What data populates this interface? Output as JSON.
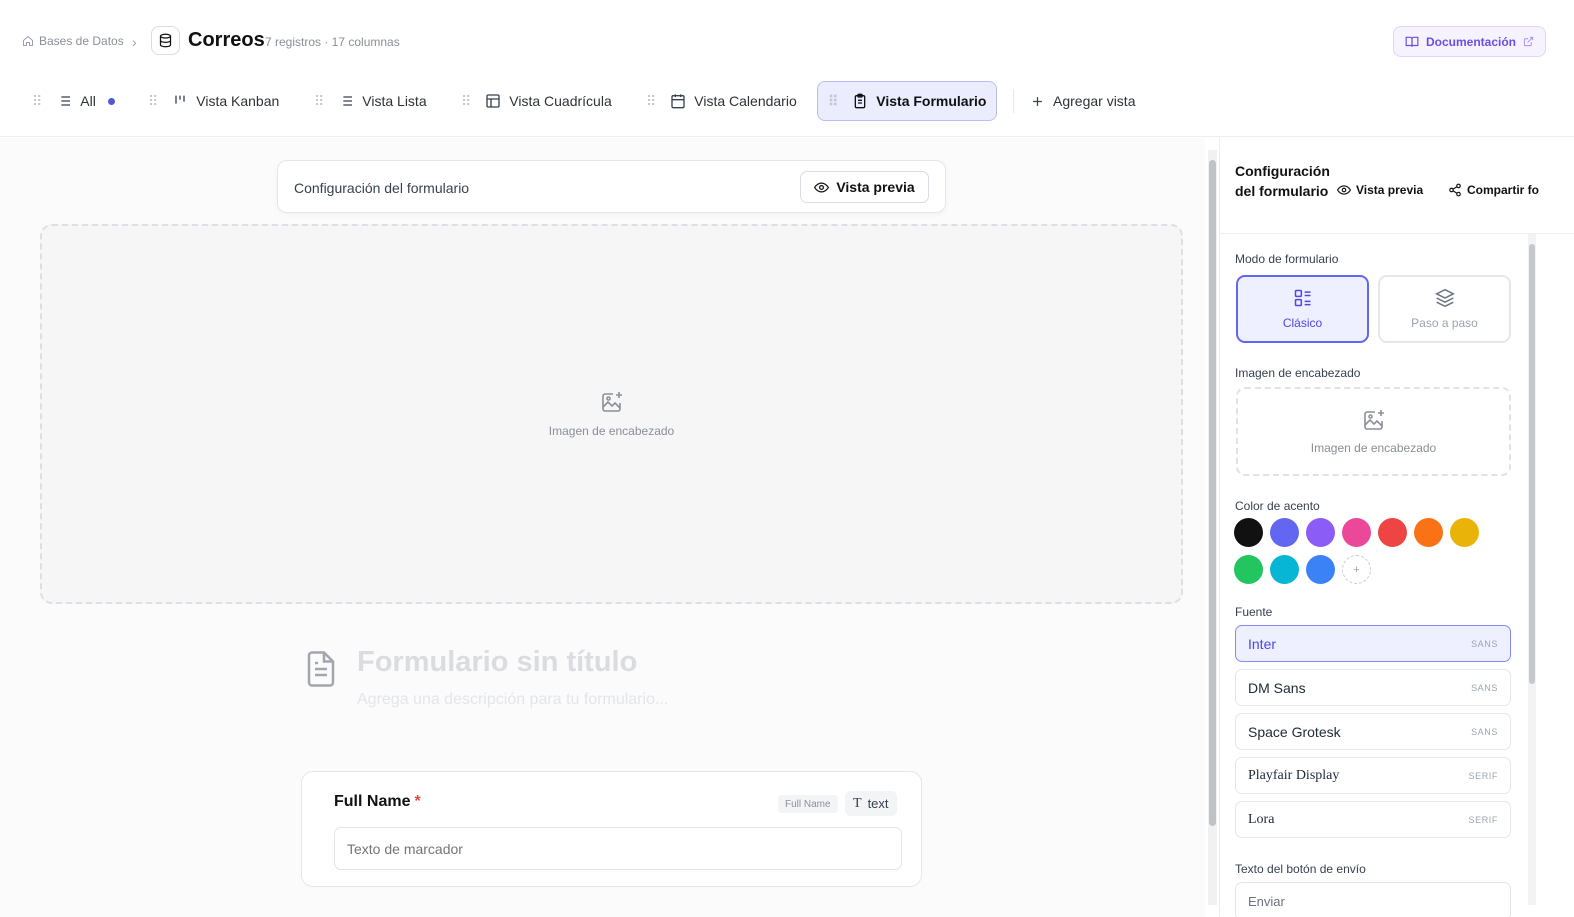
{
  "breadcrumb": {
    "root": "Bases de Datos",
    "separator": "›"
  },
  "database": {
    "title": "Correos",
    "meta": "7 registros · 17 columnas"
  },
  "docs_button": {
    "label": "Documentación"
  },
  "tabs": [
    {
      "label": "All",
      "icon": "list-icon"
    },
    {
      "label": "Vista Kanban",
      "icon": "kanban-icon"
    },
    {
      "label": "Vista Lista",
      "icon": "list-icon"
    },
    {
      "label": "Vista Cuadrícula",
      "icon": "grid-icon"
    },
    {
      "label": "Vista Calendario",
      "icon": "calendar-icon"
    },
    {
      "label": "Vista Formulario",
      "icon": "clipboard-icon"
    }
  ],
  "add_view": {
    "label": "Agregar vista"
  },
  "canvas": {
    "config_label": "Configuración del formulario",
    "preview_label": "Vista previa",
    "header_image_label": "Imagen de encabezado",
    "form_title": "Formulario sin título",
    "form_description": "Agrega una descripción para tu formulario...",
    "field": {
      "label": "Full Name",
      "required_mark": "*",
      "name_badge": "Full Name",
      "type_icon": "T",
      "type_label": "text",
      "placeholder": "Texto de marcador"
    }
  },
  "panel": {
    "title": "Configuración del formulario",
    "preview_label": "Vista previa",
    "share_label": "Compartir fo",
    "mode_label": "Modo de formulario",
    "modes": [
      {
        "label": "Clásico",
        "icon": "layout-icon"
      },
      {
        "label": "Paso a paso",
        "icon": "layers-icon"
      }
    ],
    "header_image_label": "Imagen de encabezado",
    "header_image_drop": "Imagen de encabezado",
    "accent_label": "Color de acento",
    "accent_colors": [
      "#111111",
      "#6366f1",
      "#8b5cf6",
      "#ec4899",
      "#ef4444",
      "#f97316",
      "#eab308",
      "#22c55e",
      "#06b6d4",
      "#3b82f6"
    ],
    "add_color_glyph": "+",
    "font_label": "Fuente",
    "fonts": [
      {
        "name": "Inter",
        "tag": "SANS"
      },
      {
        "name": "DM Sans",
        "tag": "SANS"
      },
      {
        "name": "Space Grotesk",
        "tag": "SANS"
      },
      {
        "name": "Playfair Display",
        "tag": "SERIF"
      },
      {
        "name": "Lora",
        "tag": "SERIF"
      }
    ],
    "submit_label": "Texto del botón de envío",
    "submit_value": "Enviar"
  }
}
